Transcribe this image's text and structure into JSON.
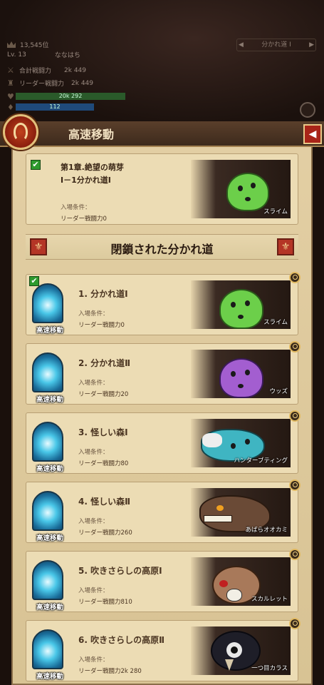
{
  "hud": {
    "rank": "13,545位",
    "level": "Lv. 13",
    "player_name": "ななはち",
    "total_power_label": "合計戦闘力",
    "total_power_value": "2k 449",
    "leader_power_label": "リーダー戦闘力",
    "leader_power_value": "2k 449",
    "hp_value": "20k 292",
    "mp_value": "112",
    "nav_label": "分かれ道 I"
  },
  "modal": {
    "title": "高速移動",
    "back_icon": "back-arrow-icon"
  },
  "current_stage": {
    "chapter": "第1章.絶望の萌芽",
    "stage": "Ⅰ－1分かれ道Ⅰ",
    "condition_label": "入場条件：",
    "condition_value": "リーダー戦闘力0",
    "monster": "スライム"
  },
  "section": {
    "title": "閉鎖された分かれ道"
  },
  "stages": [
    {
      "name": "1. 分かれ道Ⅰ",
      "condition_label": "入場条件：",
      "condition_value": "リーダー戦闘力0",
      "monster": "スライム",
      "portal_label": "高速移動",
      "checked": true
    },
    {
      "name": "2. 分かれ道Ⅱ",
      "condition_label": "入場条件：",
      "condition_value": "リーダー戦闘力20",
      "monster": "ウッズ",
      "portal_label": "高速移動",
      "checked": false
    },
    {
      "name": "3. 怪しい森Ⅰ",
      "condition_label": "入場条件：",
      "condition_value": "リーダー戦闘力80",
      "monster": "ハンターブティング",
      "portal_label": "高速移動",
      "checked": false
    },
    {
      "name": "4. 怪しい森Ⅱ",
      "condition_label": "入場条件：",
      "condition_value": "リーダー戦闘力260",
      "monster": "あばらオオカミ",
      "portal_label": "高速移動",
      "checked": false
    },
    {
      "name": "5. 吹きさらしの高原Ⅰ",
      "condition_label": "入場条件：",
      "condition_value": "リーダー戦闘力810",
      "monster": "スカルレット",
      "portal_label": "高速移動",
      "checked": false
    },
    {
      "name": "6. 吹きさらしの高原Ⅱ",
      "condition_label": "入場条件：",
      "condition_value": "リーダー戦闘力2k 280",
      "monster": "一つ目カラス",
      "portal_label": "高速移動",
      "checked": false
    }
  ],
  "colors": {
    "panel": "#e3cfa4",
    "titlebar": "#4a3322",
    "accent_red": "#a82418",
    "portal_blue": "#49c7e8"
  }
}
